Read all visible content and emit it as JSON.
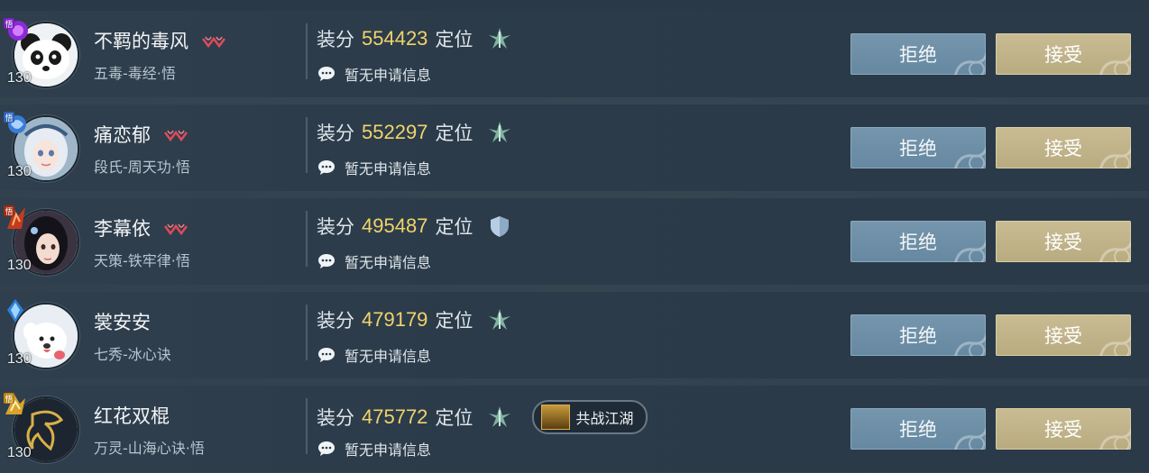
{
  "buttons": {
    "reject": "拒绝",
    "accept": "接受"
  },
  "labels": {
    "score": "装分",
    "position": "定位"
  },
  "colors": {
    "score_value": "#f0d36c",
    "reject_button": "#6f91a9",
    "accept_button": "#c1b48a"
  },
  "applicants": [
    {
      "name": "不羁的毒风",
      "badge": "red-heart-badge-icon",
      "school": "五毒-毒经·悟",
      "level": "130",
      "sect_icon": "purple-wu-icon",
      "avatar": "panda-avatar",
      "score": "554423",
      "role_icon": "dps-role-icon",
      "message": "暂无申请信息"
    },
    {
      "name": "痛恋郁",
      "badge": "red-heart-badge-icon",
      "school": "段氏-周天功·悟",
      "level": "130",
      "sect_icon": "blue-wu-icon",
      "avatar": "white-hair-girl-avatar",
      "score": "552297",
      "role_icon": "dps-role-icon",
      "message": "暂无申请信息"
    },
    {
      "name": "李幕依",
      "badge": "red-heart-badge-icon",
      "school": "天策-铁牢律·悟",
      "level": "130",
      "sect_icon": "red-wu-icon",
      "avatar": "dark-hair-girl-avatar",
      "score": "495487",
      "role_icon": "tank-shield-role-icon",
      "message": "暂无申请信息"
    },
    {
      "name": "裳安安",
      "badge": "",
      "school": "七秀-冰心诀",
      "level": "130",
      "sect_icon": "blue-gem-icon",
      "avatar": "white-dog-avatar",
      "score": "479179",
      "role_icon": "dps-role-icon",
      "message": "暂无申请信息"
    },
    {
      "name": "红花双棍",
      "badge": "",
      "school": "万灵-山海心诀·悟",
      "level": "130",
      "sect_icon": "gold-wu-icon",
      "avatar": "gold-emblem-avatar",
      "score": "475772",
      "role_icon": "dps-role-icon",
      "message": "暂无申请信息",
      "tag": "共战江湖"
    }
  ]
}
